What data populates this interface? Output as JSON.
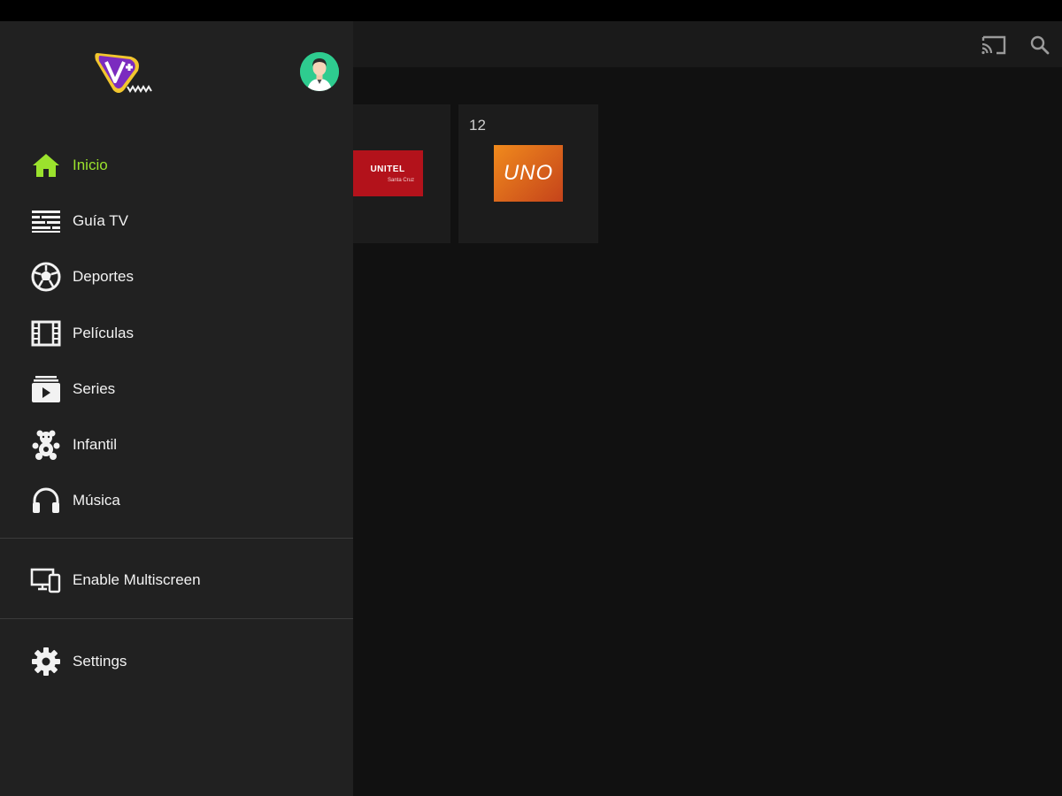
{
  "app": {
    "header_icons": [
      "cast-icon",
      "search-icon"
    ]
  },
  "channels": [
    {
      "number": "",
      "logo_text": "UNITEL",
      "logo_subtext": "Santa Cruz"
    },
    {
      "number": "12",
      "logo_text": "UNO"
    }
  ],
  "drawer": {
    "nav_items": [
      {
        "label": "Inicio",
        "icon": "home-icon",
        "active": true
      },
      {
        "label": "Guía TV",
        "icon": "tv-guide-icon",
        "active": false
      },
      {
        "label": "Deportes",
        "icon": "soccer-ball-icon",
        "active": false
      },
      {
        "label": "Películas",
        "icon": "film-icon",
        "active": false
      },
      {
        "label": "Series",
        "icon": "series-icon",
        "active": false
      },
      {
        "label": "Infantil",
        "icon": "teddy-bear-icon",
        "active": false
      },
      {
        "label": "Música",
        "icon": "headphones-icon",
        "active": false
      }
    ],
    "multiscreen_label": "Enable Multiscreen",
    "settings_label": "Settings"
  },
  "colors": {
    "accent": "#9be22d",
    "drawer_bg": "#212121",
    "content_bg": "#111111",
    "brand_purple": "#7b2bbf"
  }
}
